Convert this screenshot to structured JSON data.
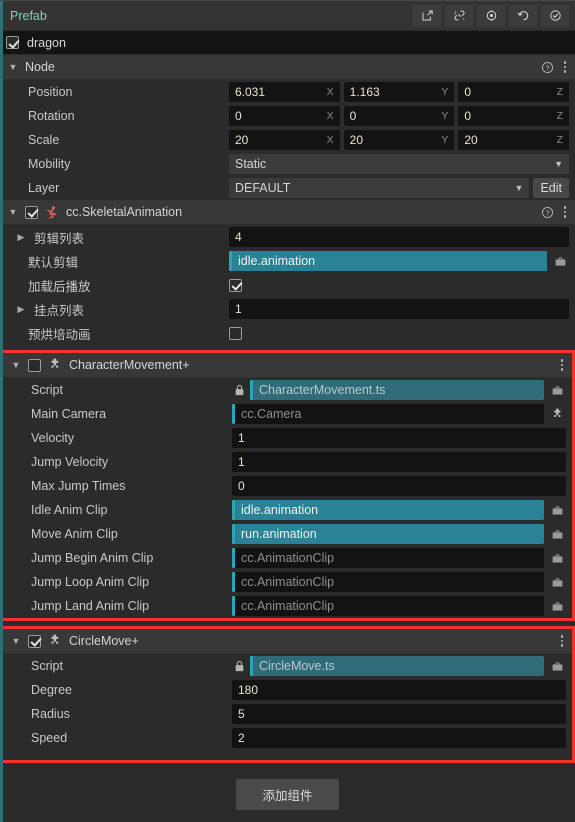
{
  "prefab": {
    "title": "Prefab",
    "buttons": [
      {
        "name": "edit-prefab-button",
        "icon": "open-in-new-icon"
      },
      {
        "name": "unlink-prefab-button",
        "icon": "broken-link-icon"
      },
      {
        "name": "locate-prefab-button",
        "icon": "target-icon"
      },
      {
        "name": "revert-prefab-button",
        "icon": "undo-icon"
      },
      {
        "name": "apply-prefab-button",
        "icon": "check-circle-icon"
      }
    ]
  },
  "node_name_row": {
    "name": "dragon",
    "enabled": true
  },
  "node": {
    "title": "Node",
    "position": {
      "label": "Position",
      "x": "6.031",
      "y": "1.163",
      "z": "0"
    },
    "rotation": {
      "label": "Rotation",
      "x": "0",
      "y": "0",
      "z": "0"
    },
    "scale": {
      "label": "Scale",
      "x": "20",
      "y": "20",
      "z": "20"
    },
    "mobility": {
      "label": "Mobility",
      "value": "Static"
    },
    "layer": {
      "label": "Layer",
      "value": "DEFAULT",
      "edit_label": "Edit"
    },
    "axes": {
      "x": "X",
      "y": "Y",
      "z": "Z"
    }
  },
  "skeletal_animation": {
    "title": "cc.SkeletalAnimation",
    "enabled": true,
    "rows": [
      {
        "label": "剪辑列表",
        "type": "array",
        "value": "4"
      },
      {
        "label": "默认剪辑",
        "type": "asset",
        "value": "idle.animation",
        "filled": true
      },
      {
        "label": "加载后播放",
        "type": "checkbox",
        "checked": true
      },
      {
        "label": "挂点列表",
        "type": "array",
        "value": "1"
      },
      {
        "label": "预烘培动画",
        "type": "checkbox",
        "checked": false
      }
    ]
  },
  "character_movement": {
    "title": "CharacterMovement+",
    "enabled": false,
    "highlighted": true,
    "rows": [
      {
        "label": "Script",
        "type": "asset",
        "value": "CharacterMovement.ts",
        "filled": true,
        "dim": true,
        "locked": true
      },
      {
        "label": "Main Camera",
        "type": "node",
        "value": "cc.Camera",
        "filled": false
      },
      {
        "label": "Velocity",
        "type": "number",
        "value": "1"
      },
      {
        "label": "Jump Velocity",
        "type": "number",
        "value": "1"
      },
      {
        "label": "Max Jump Times",
        "type": "number",
        "value": "0"
      },
      {
        "label": "Idle Anim Clip",
        "type": "asset",
        "value": "idle.animation",
        "filled": true
      },
      {
        "label": "Move Anim Clip",
        "type": "asset",
        "value": "run.animation",
        "filled": true
      },
      {
        "label": "Jump Begin Anim Clip",
        "type": "asset",
        "value": "cc.AnimationClip",
        "filled": false
      },
      {
        "label": "Jump Loop Anim Clip",
        "type": "asset",
        "value": "cc.AnimationClip",
        "filled": false
      },
      {
        "label": "Jump Land Anim Clip",
        "type": "asset",
        "value": "cc.AnimationClip",
        "filled": false
      }
    ]
  },
  "circle_move": {
    "title": "CircleMove+",
    "enabled": true,
    "highlighted": true,
    "rows": [
      {
        "label": "Script",
        "type": "asset",
        "value": "CircleMove.ts",
        "filled": true,
        "dim": true,
        "locked": true
      },
      {
        "label": "Degree",
        "type": "number",
        "value": "180"
      },
      {
        "label": "Radius",
        "type": "number",
        "value": "5"
      },
      {
        "label": "Speed",
        "type": "number",
        "value": "2"
      }
    ]
  },
  "footer": {
    "add_component_label": "添加组件"
  },
  "colors": {
    "prefab_accent": "#7fd3bb",
    "highlight": "#f4312e",
    "asset_filled": "#2a8296",
    "asset_border": "#2aa5b5",
    "left_accent": "#2e6f78"
  }
}
